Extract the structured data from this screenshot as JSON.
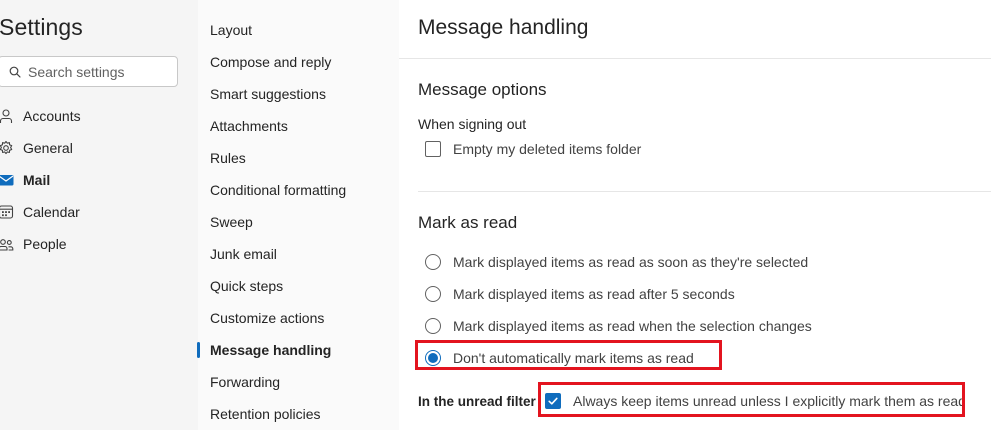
{
  "settings": {
    "title": "Settings",
    "search_placeholder": "Search settings",
    "categories": [
      {
        "label": "Accounts",
        "icon": "person-icon"
      },
      {
        "label": "General",
        "icon": "gear-icon"
      },
      {
        "label": "Mail",
        "icon": "mail-icon",
        "selected": true
      },
      {
        "label": "Calendar",
        "icon": "calendar-icon"
      },
      {
        "label": "People",
        "icon": "people-icon"
      }
    ]
  },
  "mail_nav": {
    "items": [
      "Layout",
      "Compose and reply",
      "Smart suggestions",
      "Attachments",
      "Rules",
      "Conditional formatting",
      "Sweep",
      "Junk email",
      "Quick steps",
      "Customize actions",
      "Message handling",
      "Forwarding",
      "Retention policies"
    ],
    "selected": "Message handling"
  },
  "message_handling": {
    "title": "Message handling",
    "message_options": {
      "title": "Message options",
      "signing_out_label": "When signing out",
      "empty_deleted": {
        "label": "Empty my deleted items folder",
        "checked": false
      }
    },
    "mark_as_read": {
      "title": "Mark as read",
      "options": [
        {
          "label": "Mark displayed items as read as soon as they're selected",
          "checked": false
        },
        {
          "label": "Mark displayed items as read after 5 seconds",
          "checked": false
        },
        {
          "label": "Mark displayed items as read when the selection changes",
          "checked": false
        },
        {
          "label": "Don't automatically mark items as read",
          "checked": true
        }
      ]
    },
    "unread_filter": {
      "label": "In the unread filter",
      "keep_unread": {
        "label": "Always keep items unread unless I explicitly mark them as read",
        "checked": true
      }
    }
  },
  "colors": {
    "accent": "#0f6cbd",
    "highlight": "#e3141f"
  }
}
